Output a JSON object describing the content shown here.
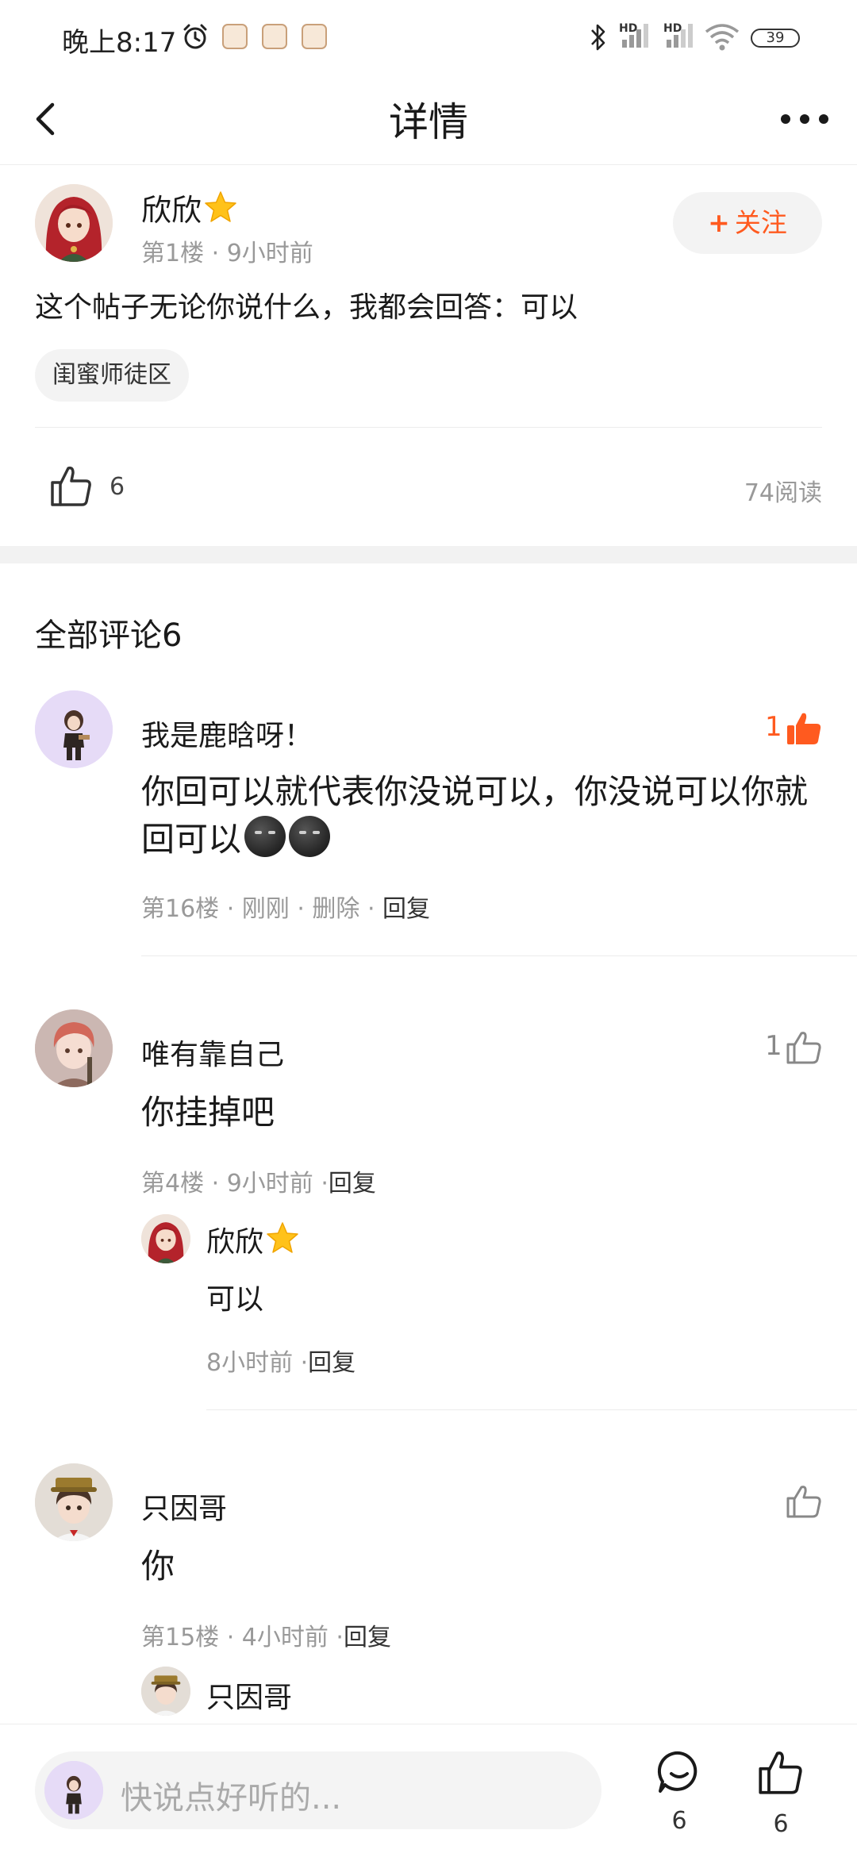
{
  "status_bar": {
    "time": "晚上8:17",
    "hd_1": "HD",
    "hd_2": "HD",
    "battery": "39"
  },
  "nav": {
    "title": "详情"
  },
  "post": {
    "author": "欣欣",
    "floor": "第1楼",
    "time": "9小时前",
    "follow_plus": "+",
    "follow_label": "关注",
    "content": "这个帖子无论你说什么，我都会回答：可以",
    "tag": "闺蜜师徒区",
    "like_count": "6",
    "reads": "74阅读"
  },
  "comments_heading": "全部评论6",
  "comments": [
    {
      "author": "我是鹿晗呀！",
      "like_count": "1",
      "text": "你回可以就代表你没说可以，你没说可以你就回可以",
      "floor": "第16楼",
      "time": "刚刚",
      "delete": "删除",
      "reply": "回复"
    },
    {
      "author": "唯有靠自己",
      "like_count": "1",
      "text": "你挂掉吧",
      "floor": "第4楼",
      "time": "9小时前",
      "reply": "回复",
      "sub_reply": {
        "author": "欣欣",
        "text": "可以",
        "time": "8小时前",
        "reply": "回复"
      }
    },
    {
      "author": "只因哥",
      "text": "你",
      "floor": "第15楼",
      "time": "4小时前",
      "reply": "回复",
      "sub_reply": {
        "author": "只因哥"
      }
    }
  ],
  "bottom_bar": {
    "placeholder": "快说点好听的...",
    "comment_count": "6",
    "like_count": "6"
  },
  "colors": {
    "accent": "#ff5a1f",
    "text_primary": "#1a1a1a",
    "text_secondary": "#999999",
    "divider": "#ececec"
  }
}
